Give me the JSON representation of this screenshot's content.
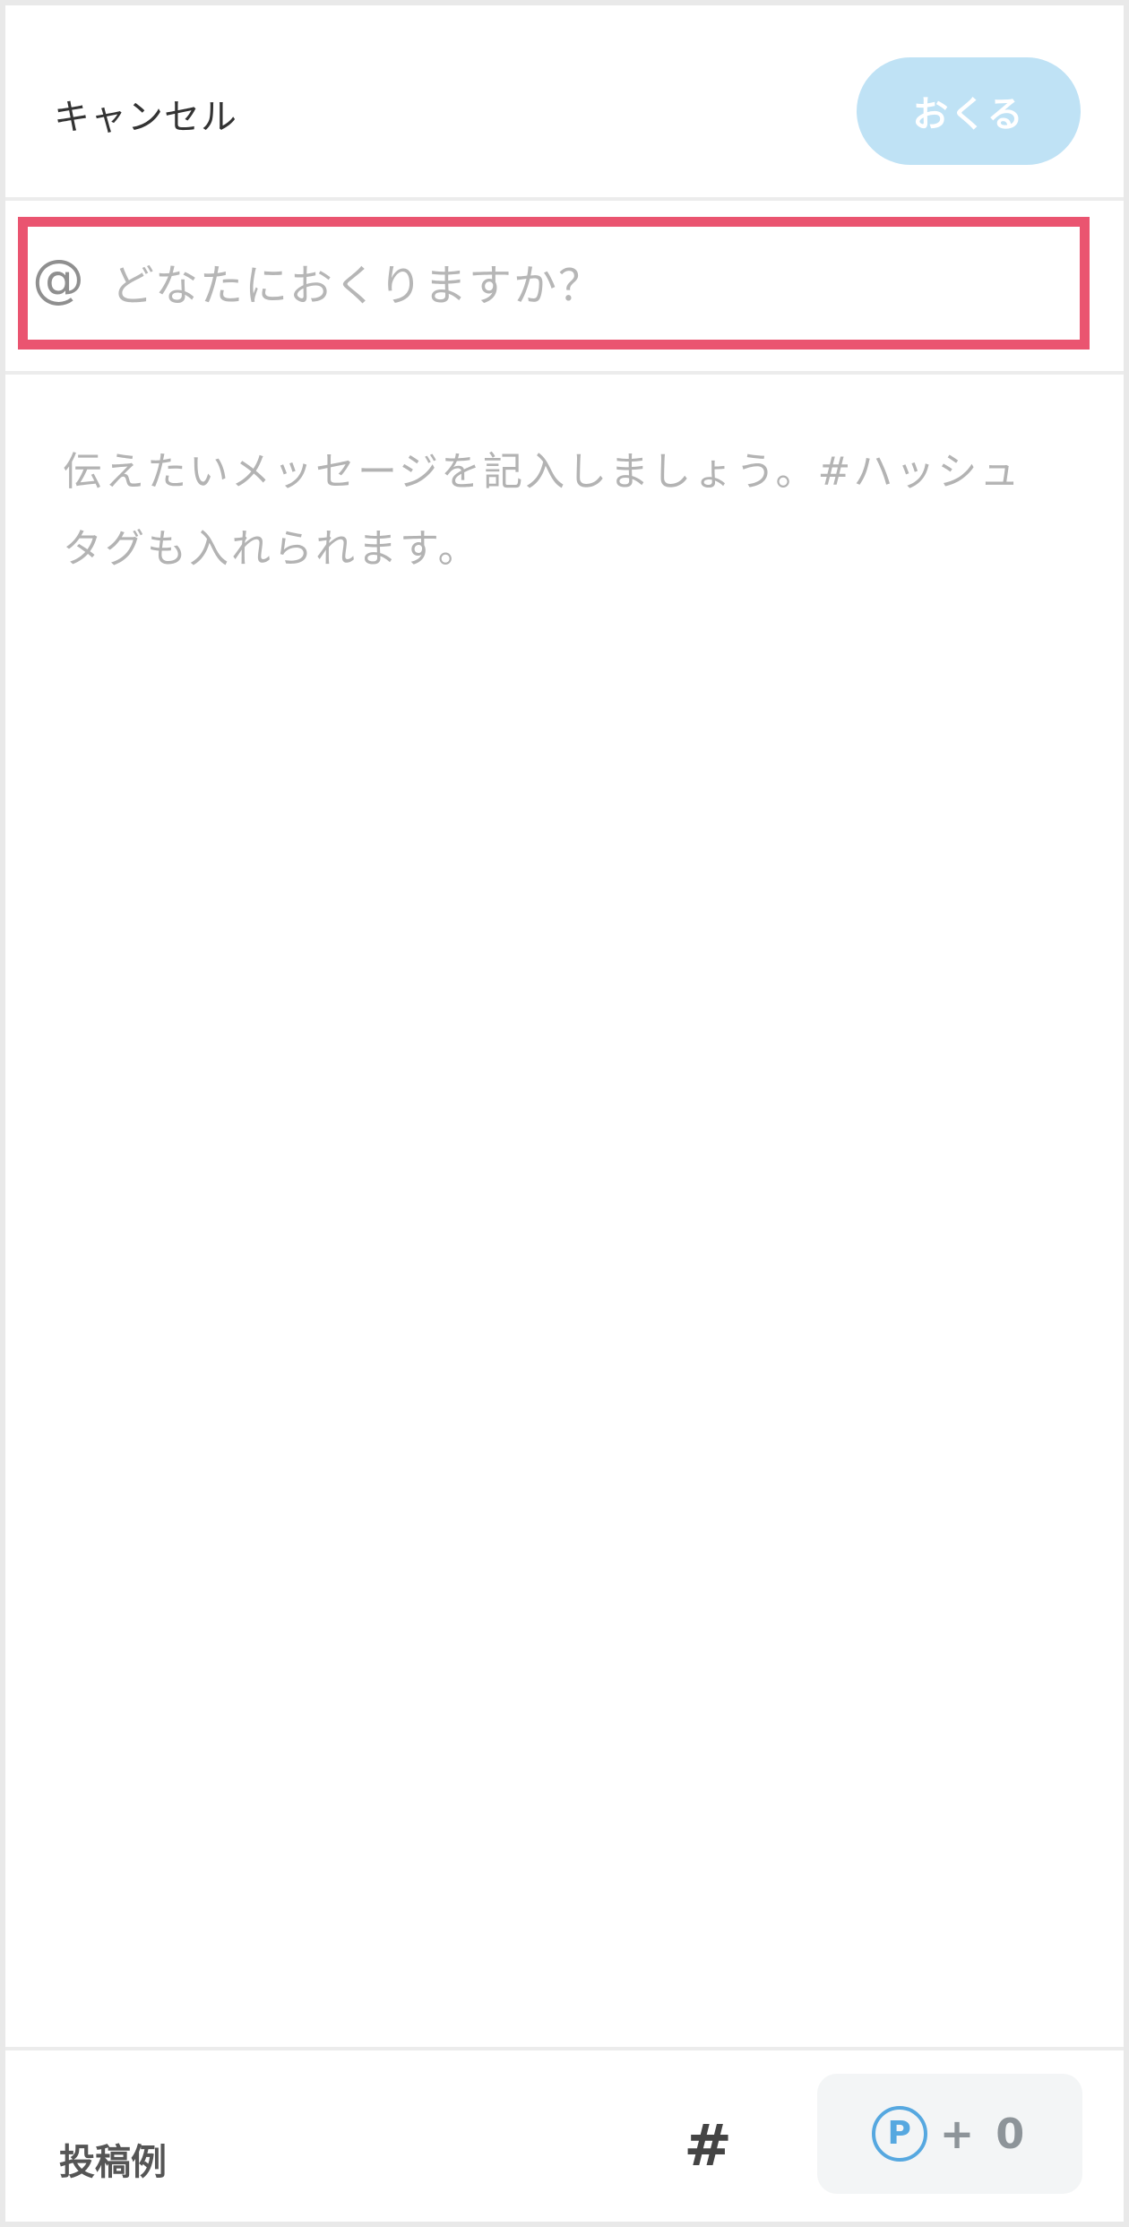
{
  "header": {
    "cancel_label": "キャンセル",
    "send_label": "おくる"
  },
  "recipient": {
    "icon": "at-icon",
    "icon_glyph": "@",
    "placeholder": "どなたにおくりますか？",
    "value": ""
  },
  "message": {
    "placeholder": "伝えたいメッセージを記入しましょう。#ハッシュタグも入れられます。",
    "value": ""
  },
  "footer": {
    "examples_label": "投稿例",
    "hashtag_icon": "hashtag-icon",
    "hashtag_glyph": "#",
    "points_icon": "point-icon",
    "points_icon_glyph": "P",
    "points_value": "+ 0"
  },
  "colors": {
    "send_button_bg": "#bfe2f5",
    "highlight_border": "#ea5470",
    "point_icon": "#56a8e0"
  }
}
